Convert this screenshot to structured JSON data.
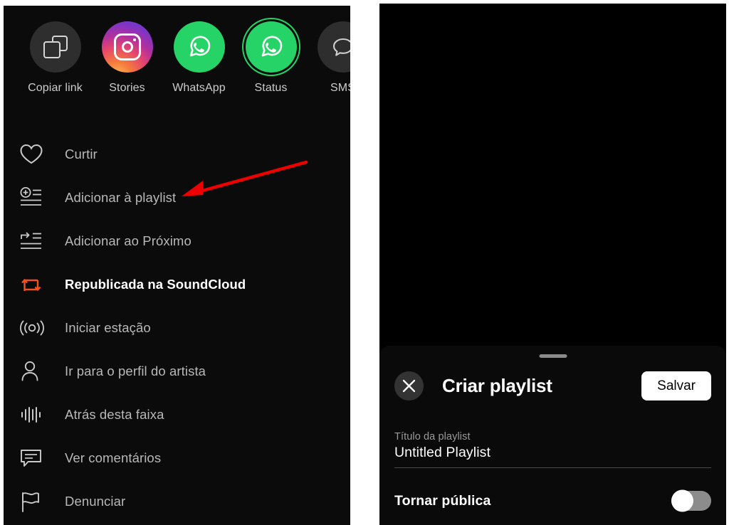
{
  "colors": {
    "panel_bg": "#0b0b0b",
    "page_bg": "#ffffff",
    "menu_text": "#b8b8b8",
    "active_text": "#ffffff",
    "repost_orange": "#f3511e",
    "whatsapp_green": "#25d366",
    "annotation_red": "#ef0000",
    "save_button_bg": "#ffffff",
    "toggle_track": "#8c8c8c"
  },
  "left_panel": {
    "share_row": [
      {
        "label": "Copiar link",
        "icon": "copy-link-icon",
        "style": "grey"
      },
      {
        "label": "Stories",
        "icon": "instagram-icon",
        "style": "instagram"
      },
      {
        "label": "WhatsApp",
        "icon": "whatsapp-icon",
        "style": "whatsapp"
      },
      {
        "label": "Status",
        "icon": "whatsapp-status-icon",
        "style": "whatsapp-status"
      },
      {
        "label": "SMS",
        "icon": "sms-icon",
        "style": "grey"
      }
    ],
    "menu_items": [
      {
        "label": "Curtir",
        "icon": "heart-icon",
        "active": false
      },
      {
        "label": "Adicionar à playlist",
        "icon": "add-to-playlist-icon",
        "active": false
      },
      {
        "label": "Adicionar ao Próximo",
        "icon": "add-to-next-up-icon",
        "active": false
      },
      {
        "label": "Republicada na SoundCloud",
        "icon": "repost-icon",
        "active": true
      },
      {
        "label": "Iniciar estação",
        "icon": "station-icon",
        "active": false
      },
      {
        "label": "Ir para o perfil do artista",
        "icon": "user-profile-icon",
        "active": false
      },
      {
        "label": "Atrás desta faixa",
        "icon": "waveform-icon",
        "active": false
      },
      {
        "label": "Ver comentários",
        "icon": "comment-icon",
        "active": false
      },
      {
        "label": "Denunciar",
        "icon": "flag-icon",
        "active": false
      }
    ],
    "annotation": {
      "name": "red-arrow-annotation",
      "points_to": "Adicionar à playlist"
    }
  },
  "right_panel": {
    "sheet": {
      "title": "Criar playlist",
      "close_label": "×",
      "save_label": "Salvar",
      "field": {
        "label": "Título da playlist",
        "value": "Untitled Playlist",
        "placeholder": "Untitled Playlist"
      },
      "toggle": {
        "label": "Tornar pública",
        "state": "off"
      }
    }
  }
}
